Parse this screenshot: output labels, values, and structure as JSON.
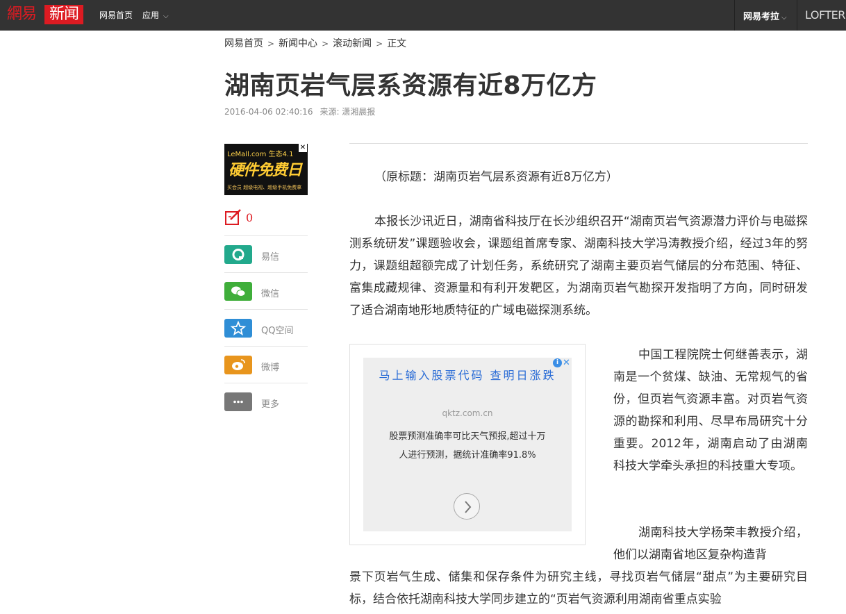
{
  "topbar": {
    "logo_left": "網易",
    "logo_right": "新闻",
    "home": "网易首页",
    "apps": "应用",
    "kaola": "网易考拉",
    "lofter": "LOFTER"
  },
  "breadcrumb": [
    "网易首页",
    "新闻中心",
    "滚动新闻",
    "正文"
  ],
  "article": {
    "title": "湖南页岩气层系资源有近8万亿方",
    "date": "2016-04-06 02:40:16",
    "source": "来源: 潇湘晨报",
    "p1": "（原标题：湖南页岩气层系资源有近8万亿方）",
    "p2": "本报长沙讯近日，湖南省科技厅在长沙组织召开“湖南页岩气资源潜力评价与电磁探测系统研发”课题验收会，课题组首席专家、湖南科技大学冯涛教授介绍，经过3年的努力，课题组超额完成了计划任务，系统研究了湖南主要页岩气储层的分布范围、特征、富集成藏规律、资源量和有利开发靶区，为湖南页岩气勘探开发指明了方向，同时研发了适合湖南地形地质特征的广域电磁探测系统。",
    "p3": "中国工程院院士何继善表示，湖南是一个贫煤、缺油、无常规气的省份，但页岩气资源丰富。对页岩气资源的勘探和利用、尽早布局研究十分重要。2012年，湖南启动了由湖南科技大学牵头承担的科技重大专项。",
    "p4a": "湖南科技大学杨荣丰教授介绍，他们以湖南省地区复杂构造背",
    "p4b": "景下页岩气生成、储集和保存条件为研究主线，寻找页岩气储层“甜点”为主要研究目标，结合依托湖南科技大学同步建立的“页岩气资源利用湖南省重点实验"
  },
  "side_ad": {
    "line1": "LeMall.com 生态4.1",
    "line2": "硬件免费日",
    "line3": "买会员 超级电视、超级手机免费拿"
  },
  "comments": {
    "count": "0"
  },
  "share": [
    {
      "label": "易信",
      "color": "#22a98c",
      "icon": "yixin-icon"
    },
    {
      "label": "微信",
      "color": "#3fae3a",
      "icon": "wechat-icon"
    },
    {
      "label": "QQ空间",
      "color": "#2f8ed6",
      "icon": "qzone-icon"
    },
    {
      "label": "微博",
      "color": "#e8951d",
      "icon": "weibo-icon"
    },
    {
      "label": "更多",
      "color": "#777777",
      "icon": "more-icon"
    }
  ],
  "float_ad": {
    "headline": "马上输入股票代码 查明日涨跌",
    "domain": "qktz.com.cn",
    "desc": "股票预测准确率可比天气预报,超过十万 人进行预测，据统计准确率91.8%"
  }
}
